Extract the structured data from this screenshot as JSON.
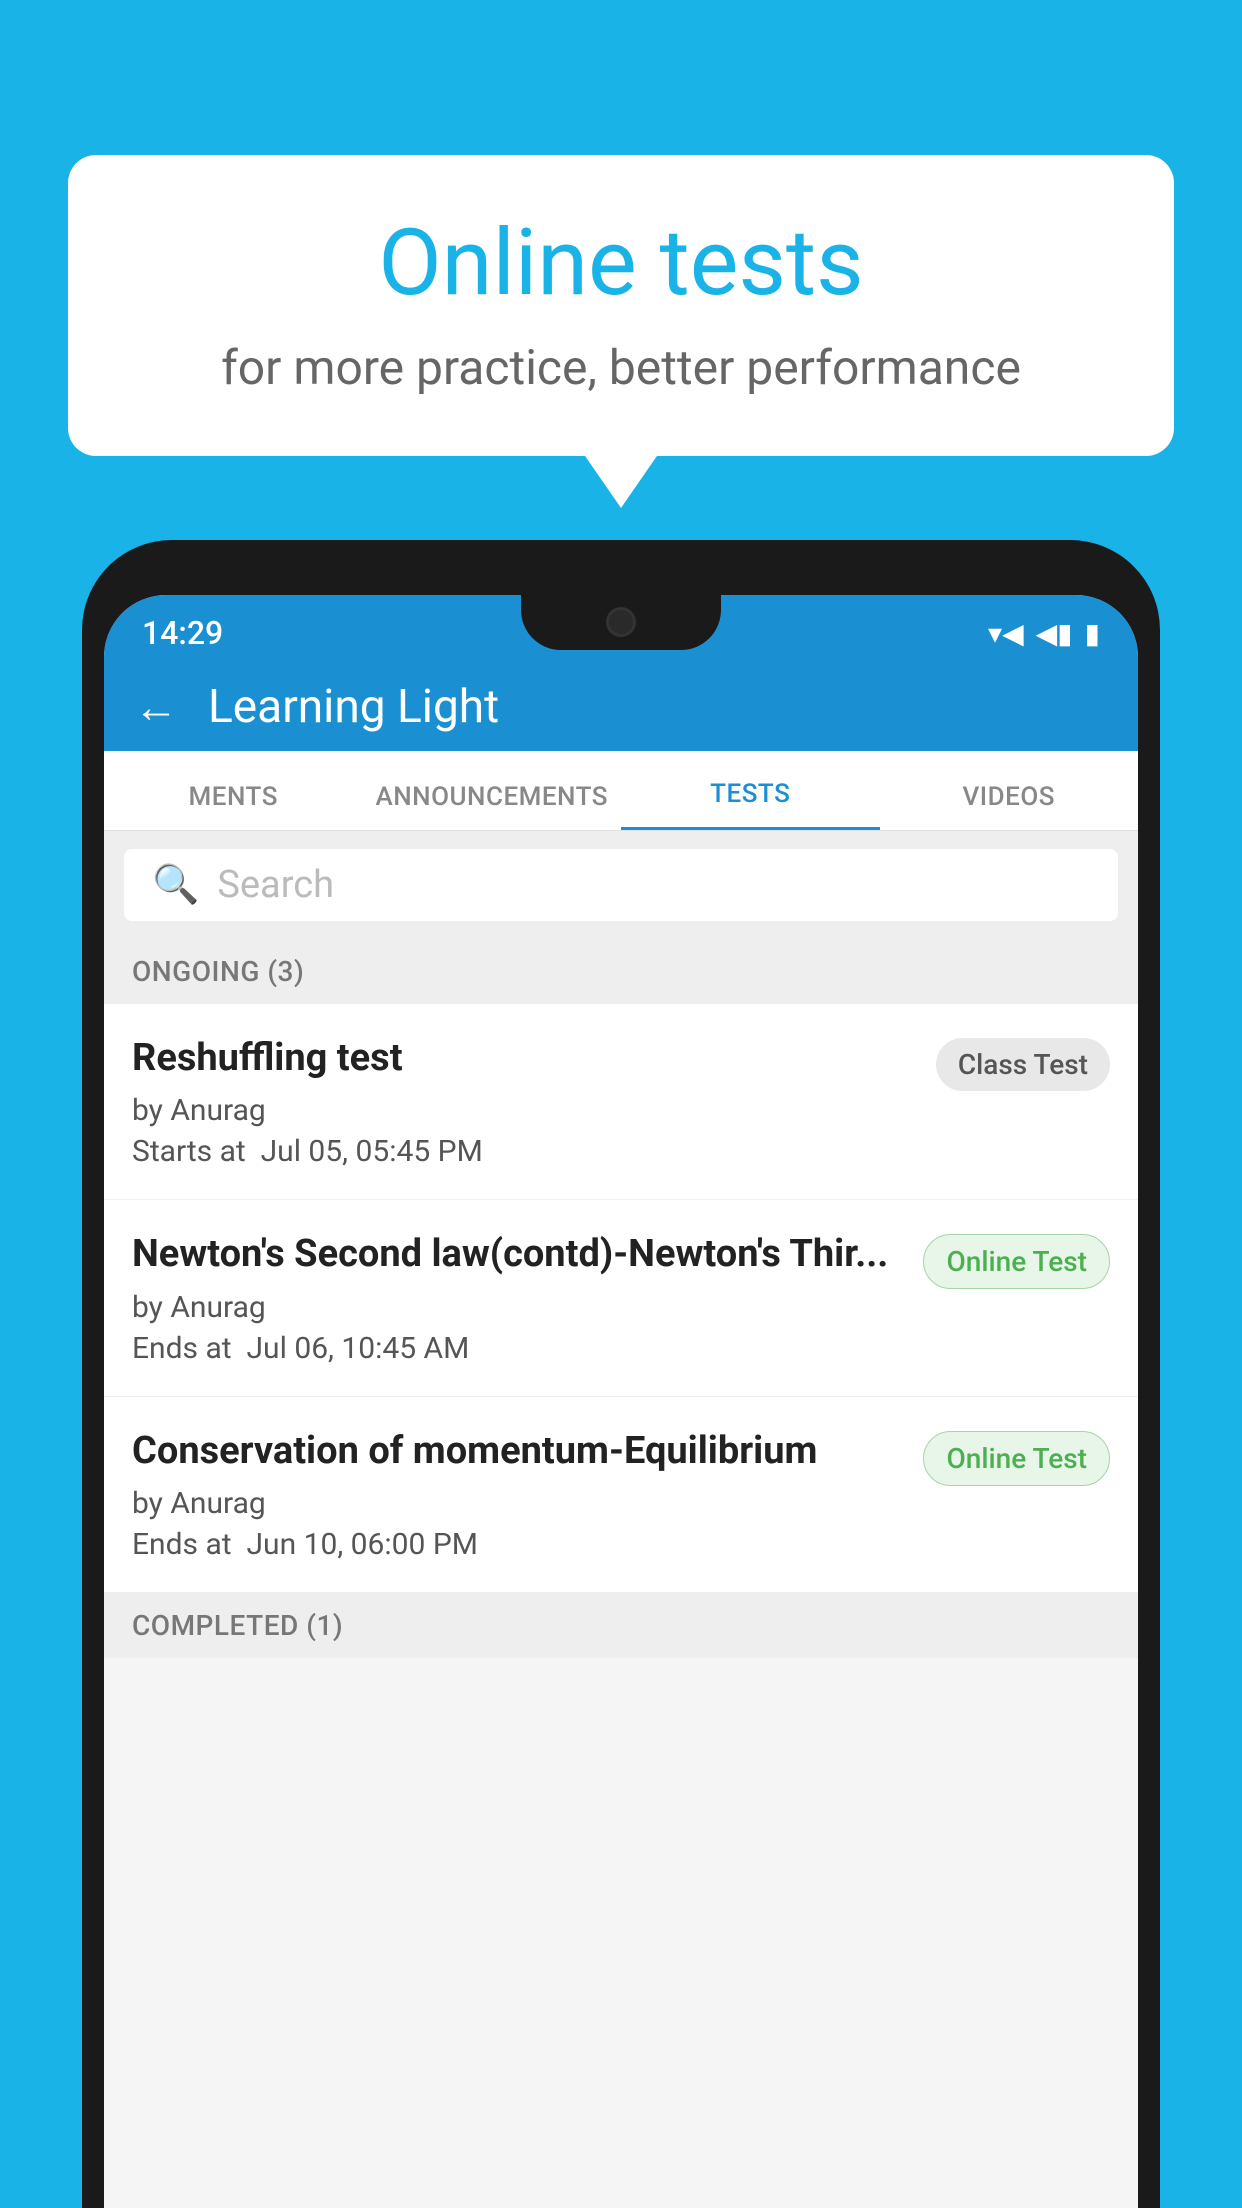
{
  "background_color": "#1ab3e8",
  "speech_bubble": {
    "title": "Online tests",
    "subtitle": "for more practice, better performance"
  },
  "phone": {
    "status_bar": {
      "time": "14:29",
      "icons": [
        "wifi",
        "signal",
        "battery"
      ]
    },
    "app_header": {
      "title": "Learning Light",
      "back_label": "←"
    },
    "tabs": [
      {
        "label": "MENTS",
        "active": false
      },
      {
        "label": "ANNOUNCEMENTS",
        "active": false
      },
      {
        "label": "TESTS",
        "active": true
      },
      {
        "label": "VIDEOS",
        "active": false
      }
    ],
    "search": {
      "placeholder": "Search"
    },
    "ongoing_section": {
      "label": "ONGOING (3)"
    },
    "tests": [
      {
        "name": "Reshuffling test",
        "by": "by Anurag",
        "time_label": "Starts at",
        "time_value": "Jul 05, 05:45 PM",
        "badge": "Class Test",
        "badge_type": "class"
      },
      {
        "name": "Newton's Second law(contd)-Newton's Thir...",
        "by": "by Anurag",
        "time_label": "Ends at",
        "time_value": "Jul 06, 10:45 AM",
        "badge": "Online Test",
        "badge_type": "online"
      },
      {
        "name": "Conservation of momentum-Equilibrium",
        "by": "by Anurag",
        "time_label": "Ends at",
        "time_value": "Jun 10, 06:00 PM",
        "badge": "Online Test",
        "badge_type": "online"
      }
    ],
    "completed_section": {
      "label": "COMPLETED (1)"
    }
  }
}
